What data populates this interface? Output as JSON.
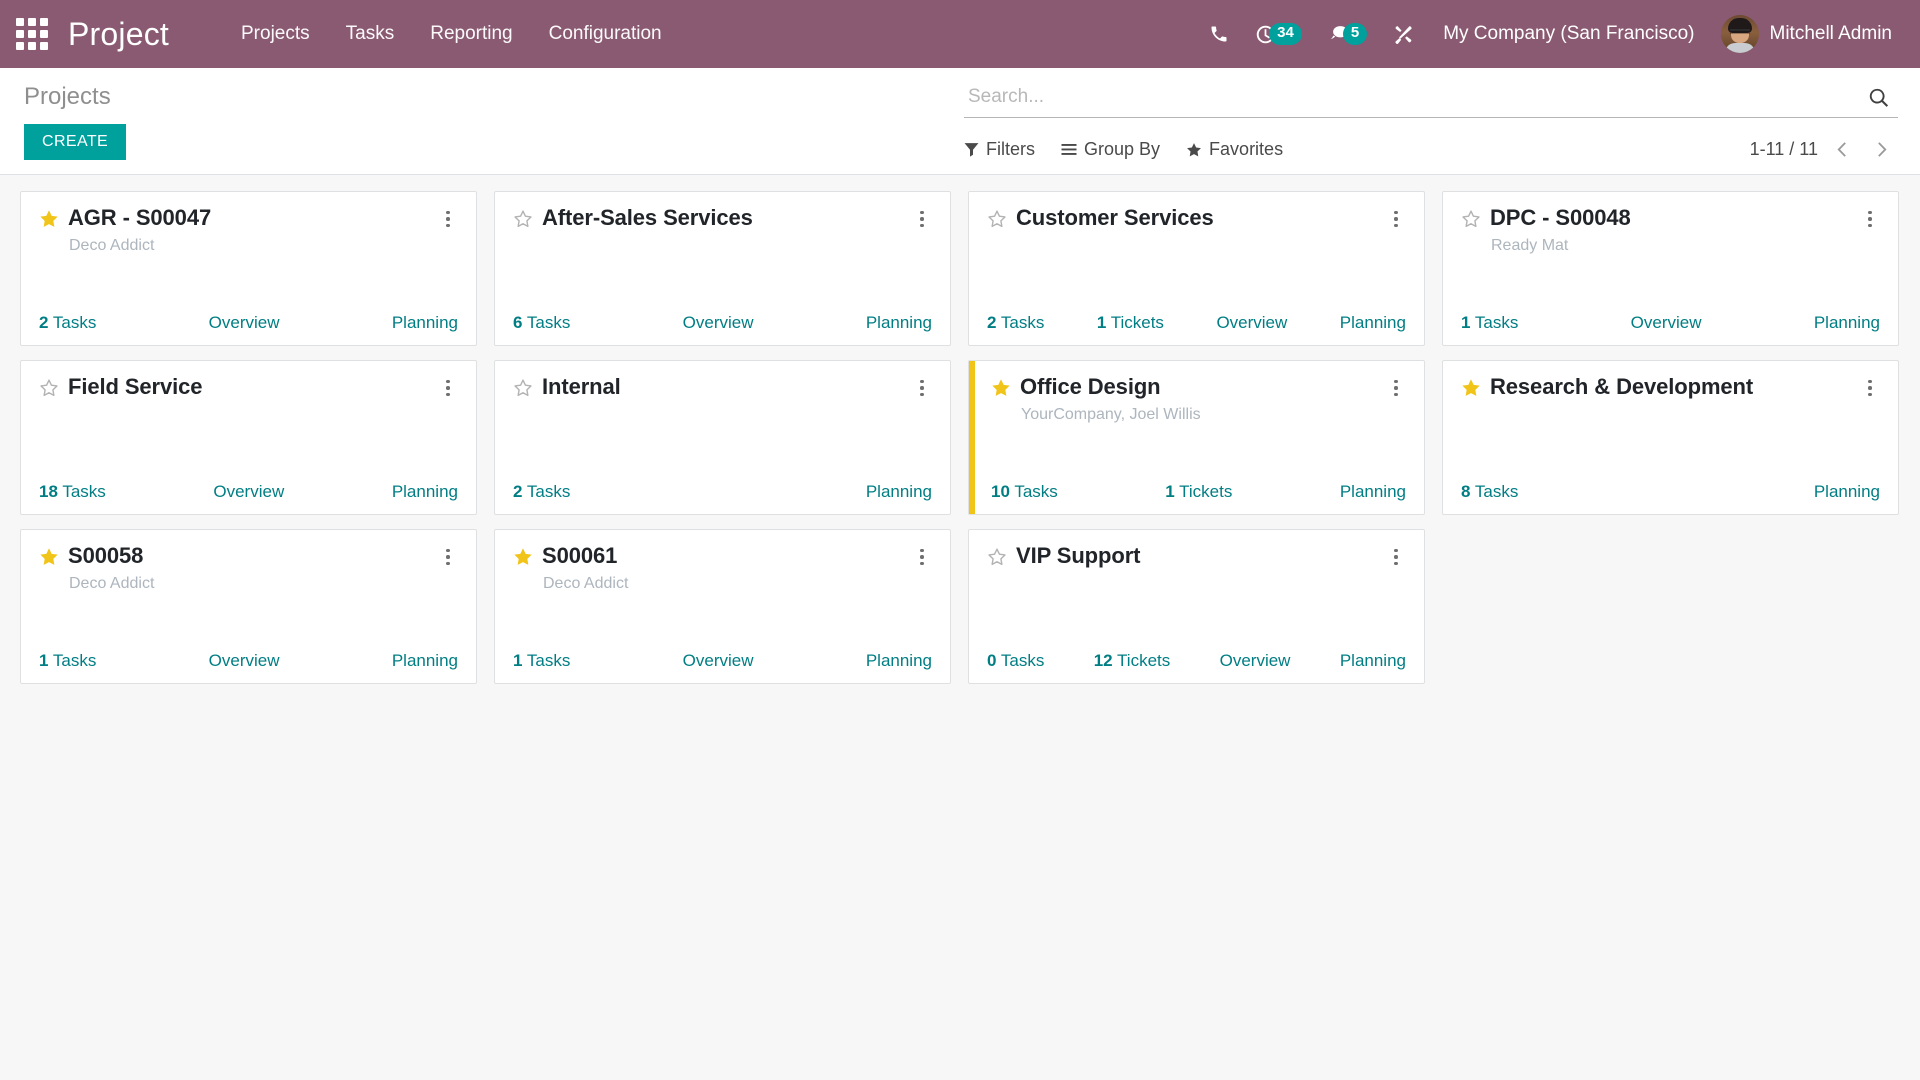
{
  "navbar": {
    "apps_icon": "apps-grid-icon",
    "brand": "Project",
    "menu": [
      {
        "label": "Projects"
      },
      {
        "label": "Tasks"
      },
      {
        "label": "Reporting"
      },
      {
        "label": "Configuration"
      }
    ],
    "systray": {
      "phone_icon": "phone-icon",
      "activity_icon": "activity-clock-icon",
      "activity_count": "34",
      "messages_icon": "chat-bubble-icon",
      "messages_count": "5",
      "debug_icon": "tools-wrench-icon"
    },
    "company": "My Company (San Francisco)",
    "user": {
      "name": "Mitchell Admin",
      "avatar_icon": "user-avatar"
    },
    "accent_purple": "#8A5A72",
    "accent_teal": "#00A09D"
  },
  "control_panel": {
    "breadcrumb": "Projects",
    "create_label": "CREATE",
    "search": {
      "placeholder": "Search...",
      "value": "",
      "icon": "search-icon"
    },
    "filters": [
      {
        "label": "Filters",
        "icon": "filter-funnel-icon"
      },
      {
        "label": "Group By",
        "icon": "group-by-lines-icon"
      },
      {
        "label": "Favorites",
        "icon": "star-filled-icon"
      }
    ],
    "pager": {
      "value": "1-11 / 11",
      "prev_icon": "chevron-left-icon",
      "next_icon": "chevron-right-icon"
    }
  },
  "kanban": {
    "cards": [
      {
        "title": "AGR - S00047",
        "subtitle": "Deco Addict",
        "favorite": true,
        "stripe_color": null,
        "links": [
          {
            "count": "2",
            "label": " Tasks"
          },
          {
            "count": "",
            "label": "Overview"
          },
          {
            "count": "",
            "label": "Planning"
          }
        ]
      },
      {
        "title": "After-Sales Services",
        "subtitle": "",
        "favorite": false,
        "stripe_color": null,
        "links": [
          {
            "count": "6",
            "label": " Tasks"
          },
          {
            "count": "",
            "label": "Overview"
          },
          {
            "count": "",
            "label": "Planning"
          }
        ]
      },
      {
        "title": "Customer Services",
        "subtitle": "",
        "favorite": false,
        "stripe_color": null,
        "links": [
          {
            "count": "2",
            "label": " Tasks"
          },
          {
            "count": "1",
            "label": " Tickets"
          },
          {
            "count": "",
            "label": "Overview"
          },
          {
            "count": "",
            "label": "Planning"
          }
        ]
      },
      {
        "title": "DPC - S00048",
        "subtitle": "Ready Mat",
        "favorite": false,
        "stripe_color": null,
        "links": [
          {
            "count": "1",
            "label": " Tasks"
          },
          {
            "count": "",
            "label": "Overview"
          },
          {
            "count": "",
            "label": "Planning"
          }
        ]
      },
      {
        "title": "Field Service",
        "subtitle": "",
        "favorite": false,
        "stripe_color": null,
        "links": [
          {
            "count": "18",
            "label": " Tasks"
          },
          {
            "count": "",
            "label": "Overview"
          },
          {
            "count": "",
            "label": "Planning"
          }
        ]
      },
      {
        "title": "Internal",
        "subtitle": "",
        "favorite": false,
        "stripe_color": null,
        "links": [
          {
            "count": "2",
            "label": " Tasks"
          },
          {
            "count": "",
            "label": "Planning"
          }
        ]
      },
      {
        "title": "Office Design",
        "subtitle": "YourCompany, Joel Willis",
        "favorite": true,
        "stripe_color": "#F0C419",
        "links": [
          {
            "count": "10",
            "label": " Tasks"
          },
          {
            "count": "1",
            "label": " Tickets"
          },
          {
            "count": "",
            "label": "Planning"
          }
        ]
      },
      {
        "title": "Research & Development",
        "subtitle": "",
        "favorite": true,
        "stripe_color": null,
        "links": [
          {
            "count": "8",
            "label": " Tasks"
          },
          {
            "count": "",
            "label": "Planning"
          }
        ]
      },
      {
        "title": "S00058",
        "subtitle": "Deco Addict",
        "favorite": true,
        "stripe_color": null,
        "links": [
          {
            "count": "1",
            "label": " Tasks"
          },
          {
            "count": "",
            "label": "Overview"
          },
          {
            "count": "",
            "label": "Planning"
          }
        ]
      },
      {
        "title": "S00061",
        "subtitle": "Deco Addict",
        "favorite": true,
        "stripe_color": null,
        "links": [
          {
            "count": "1",
            "label": " Tasks"
          },
          {
            "count": "",
            "label": "Overview"
          },
          {
            "count": "",
            "label": "Planning"
          }
        ]
      },
      {
        "title": "VIP Support",
        "subtitle": "",
        "favorite": false,
        "stripe_color": null,
        "links": [
          {
            "count": "0",
            "label": " Tasks"
          },
          {
            "count": "12",
            "label": " Tickets"
          },
          {
            "count": "",
            "label": "Overview"
          },
          {
            "count": "",
            "label": "Planning"
          }
        ]
      }
    ]
  }
}
